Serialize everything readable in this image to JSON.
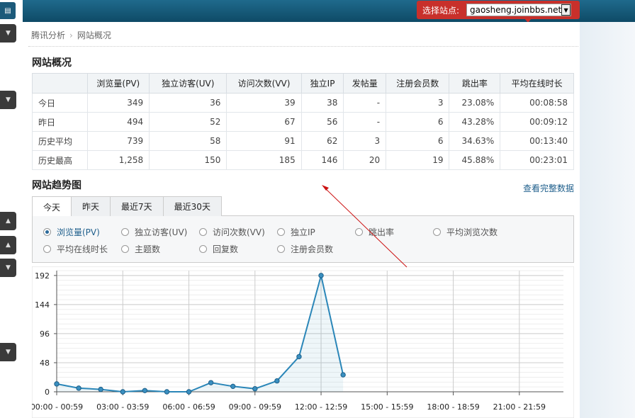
{
  "top": {
    "site_label": "选择站点:",
    "site_value": "gaosheng.joinbbs.net"
  },
  "breadcrumb": [
    "腾讯分析",
    "网站概况"
  ],
  "overview": {
    "title": "网站概况",
    "columns": [
      "",
      "浏览量(PV)",
      "独立访客(UV)",
      "访问次数(VV)",
      "独立IP",
      "发帖量",
      "注册会员数",
      "跳出率",
      "平均在线时长"
    ],
    "rows": [
      [
        "今日",
        "349",
        "36",
        "39",
        "38",
        "-",
        "3",
        "23.08%",
        "00:08:58"
      ],
      [
        "昨日",
        "494",
        "52",
        "67",
        "56",
        "-",
        "6",
        "43.28%",
        "00:09:12"
      ],
      [
        "历史平均",
        "739",
        "58",
        "91",
        "62",
        "3",
        "6",
        "34.63%",
        "00:13:40"
      ],
      [
        "历史最高",
        "1,258",
        "150",
        "185",
        "146",
        "20",
        "19",
        "45.88%",
        "00:23:01"
      ]
    ]
  },
  "trend": {
    "title": "网站趋势图",
    "full_link": "查看完整数据",
    "tabs": [
      "今天",
      "昨天",
      "最近7天",
      "最近30天"
    ],
    "options": [
      "浏览量(PV)",
      "独立访客(UV)",
      "访问次数(VV)",
      "独立IP",
      "跳出率",
      "平均浏览次数",
      "平均在线时长",
      "主题数",
      "回复数",
      "注册会员数"
    ],
    "selected_option": 0
  },
  "colors": {
    "header": "#135577",
    "site_select": "#c8302b",
    "line": "#2a86b8",
    "annotation": "#cc1111"
  },
  "chart_data": {
    "type": "line",
    "x_tick_labels": [
      "00:00 - 00:59",
      "03:00 - 03:59",
      "06:00 - 06:59",
      "09:00 - 09:59",
      "12:00 - 12:59",
      "15:00 - 15:59",
      "18:00 - 18:59",
      "21:00 - 21:59"
    ],
    "x": [
      0,
      1,
      2,
      3,
      4,
      5,
      6,
      7,
      8,
      9,
      10,
      11,
      12,
      13
    ],
    "values": [
      13,
      6,
      4,
      0,
      2,
      0,
      0,
      15,
      9,
      5,
      18,
      58,
      192,
      28
    ],
    "yticks": [
      0,
      48,
      96,
      144,
      192
    ],
    "ylim": [
      0,
      200
    ],
    "xlim": [
      0,
      23
    ],
    "grid": true
  }
}
